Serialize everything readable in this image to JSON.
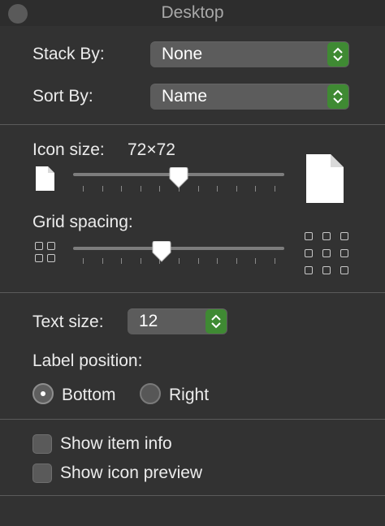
{
  "window": {
    "title": "Desktop"
  },
  "stack_by": {
    "label": "Stack By:",
    "value": "None"
  },
  "sort_by": {
    "label": "Sort By:",
    "value": "Name"
  },
  "icon_size": {
    "label": "Icon size:",
    "value_text": "72×72",
    "level": 0.5
  },
  "grid_spacing": {
    "label": "Grid spacing:",
    "level": 0.42
  },
  "text_size": {
    "label": "Text size:",
    "value": "12"
  },
  "label_position": {
    "label": "Label position:",
    "options": [
      "Bottom",
      "Right"
    ],
    "selected": "Bottom"
  },
  "checkboxes": {
    "show_item_info": {
      "label": "Show item info",
      "checked": false
    },
    "show_icon_preview": {
      "label": "Show icon preview",
      "checked": false
    }
  },
  "colors": {
    "background": "#323232",
    "stepper_accent": "#3f8a33",
    "text": "#ececec"
  },
  "icons": [
    "close-icon",
    "small-document-icon",
    "large-document-icon",
    "grid-tight-icon",
    "grid-wide-icon",
    "chevron-updown-icon"
  ]
}
